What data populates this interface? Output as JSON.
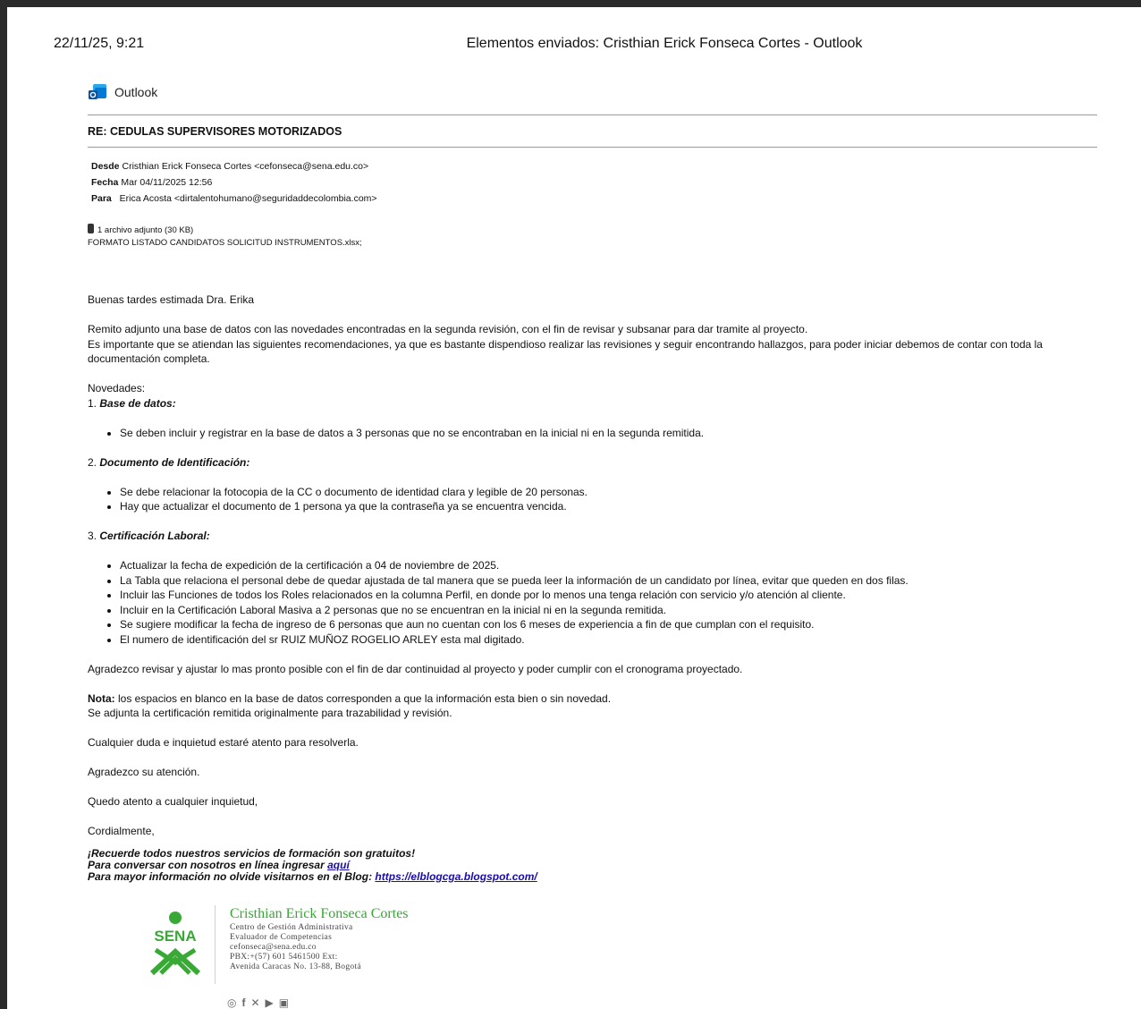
{
  "print_header": {
    "date": "22/11/25, 9:21",
    "title": "Elementos enviados: Cristhian Erick Fonseca Cortes - Outlook"
  },
  "brand": {
    "label": "Outlook",
    "icon": "outlook-icon"
  },
  "email": {
    "subject": "RE: CEDULAS SUPERVISORES MOTORIZADOS",
    "from_label": "Desde",
    "from": "Cristhian Erick Fonseca Cortes <cefonseca@sena.edu.co>",
    "date_label": "Fecha",
    "date": "Mar 04/11/2025 12:56",
    "to_label": "Para",
    "to": "Erica Acosta <dirtalentohumano@seguridaddecolombia.com>",
    "attachment_summary": "1 archivo adjunto (30 KB)",
    "attachment_name": "FORMATO LISTADO CANDIDATOS SOLICITUD INSTRUMENTOS.xlsx;"
  },
  "body": {
    "greeting": "Buenas tardes estimada Dra. Erika",
    "para1": "Remito adjunto una base de datos con las novedades encontradas en la segunda revisión, con el fin de revisar y subsanar para dar tramite al proyecto.",
    "para2": "Es importante que se atiendan las siguientes recomendaciones, ya que es bastante dispendioso realizar las revisiones y seguir encontrando hallazgos, para poder iniciar debemos de contar con toda la documentación completa.",
    "novedades": "Novedades:",
    "sections": [
      {
        "num": "1.",
        "title": "Base de datos:",
        "items": [
          "Se deben incluir y registrar en la base de datos a 3 personas que no se encontraban en la inicial ni en la segunda remitida."
        ]
      },
      {
        "num": "2.",
        "title": "Documento de Identificación:",
        "items": [
          "Se debe relacionar la fotocopia de la CC o documento de identidad clara y legible de 20 personas.",
          "Hay que actualizar el documento de 1 persona ya que la contraseña ya se encuentra vencida."
        ]
      },
      {
        "num": "3.",
        "title": "Certificación Laboral:",
        "items": [
          "Actualizar la fecha de expedición de la certificación a 04 de noviembre de 2025.",
          "La Tabla que relaciona el personal debe de quedar ajustada de tal manera que se pueda leer la información de un candidato por línea, evitar que queden en dos filas.",
          "Incluir las Funciones de todos los Roles relacionados en la columna Perfil, en donde por lo menos una tenga relación con servicio y/o atención al cliente.",
          "Incluir en la Certificación Laboral Masiva a 2 personas que no se encuentran en la inicial ni en la segunda remitida.",
          "Se sugiere modificar la fecha de ingreso de 6 personas que aun no cuentan con los 6 meses de experiencia a fin de que cumplan con el requisito.",
          "El numero de identificación del sr RUIZ MUÑOZ  ROGELIO ARLEY esta mal digitado."
        ]
      }
    ],
    "closing1": "Agradezco revisar y ajustar lo mas pronto posible con el fin de dar continuidad al proyecto y poder cumplir con el cronograma proyectado.",
    "note_label": "Nota:",
    "note": " los espacios en blanco en la base de datos corresponden a que la información esta bien o sin novedad.",
    "note2": "Se adjunta la certificación remitida originalmente para trazabilidad y revisión.",
    "closing2": "Cualquier duda e inquietud estaré atento para resolverla.",
    "closing3": "Agradezco su atención.",
    "closing4": "Quedo atento a cualquier inquietud,",
    "signoff": "Cordialmente,",
    "promo1": "¡Recuerde todos nuestros servicios de formación son gratuitos!",
    "promo2": "Para conversar con nosotros en línea ingresar ",
    "promo2_link": "aquí",
    "promo3": "Para mayor información no olvide visitarnos en el Blog: ",
    "promo3_link": "https://elblogcga.blogspot.com/"
  },
  "signature": {
    "logo_text": "SENA",
    "name": "Cristhian Erick Fonseca Cortes",
    "org": "Centro de Gestión Administrativa",
    "role": "Evaluador de Competencias",
    "email": "cefonseca@sena.edu.co",
    "phone": "PBX:+(57) 601 5461500 Ext:",
    "address": "Avenida Caracas No. 13-88, Bogotá",
    "social_icons": [
      "instagram-icon",
      "facebook-icon",
      "twitter-icon",
      "youtube-icon",
      "linkedin-icon"
    ],
    "colors": {
      "green": "#3aa537"
    }
  }
}
